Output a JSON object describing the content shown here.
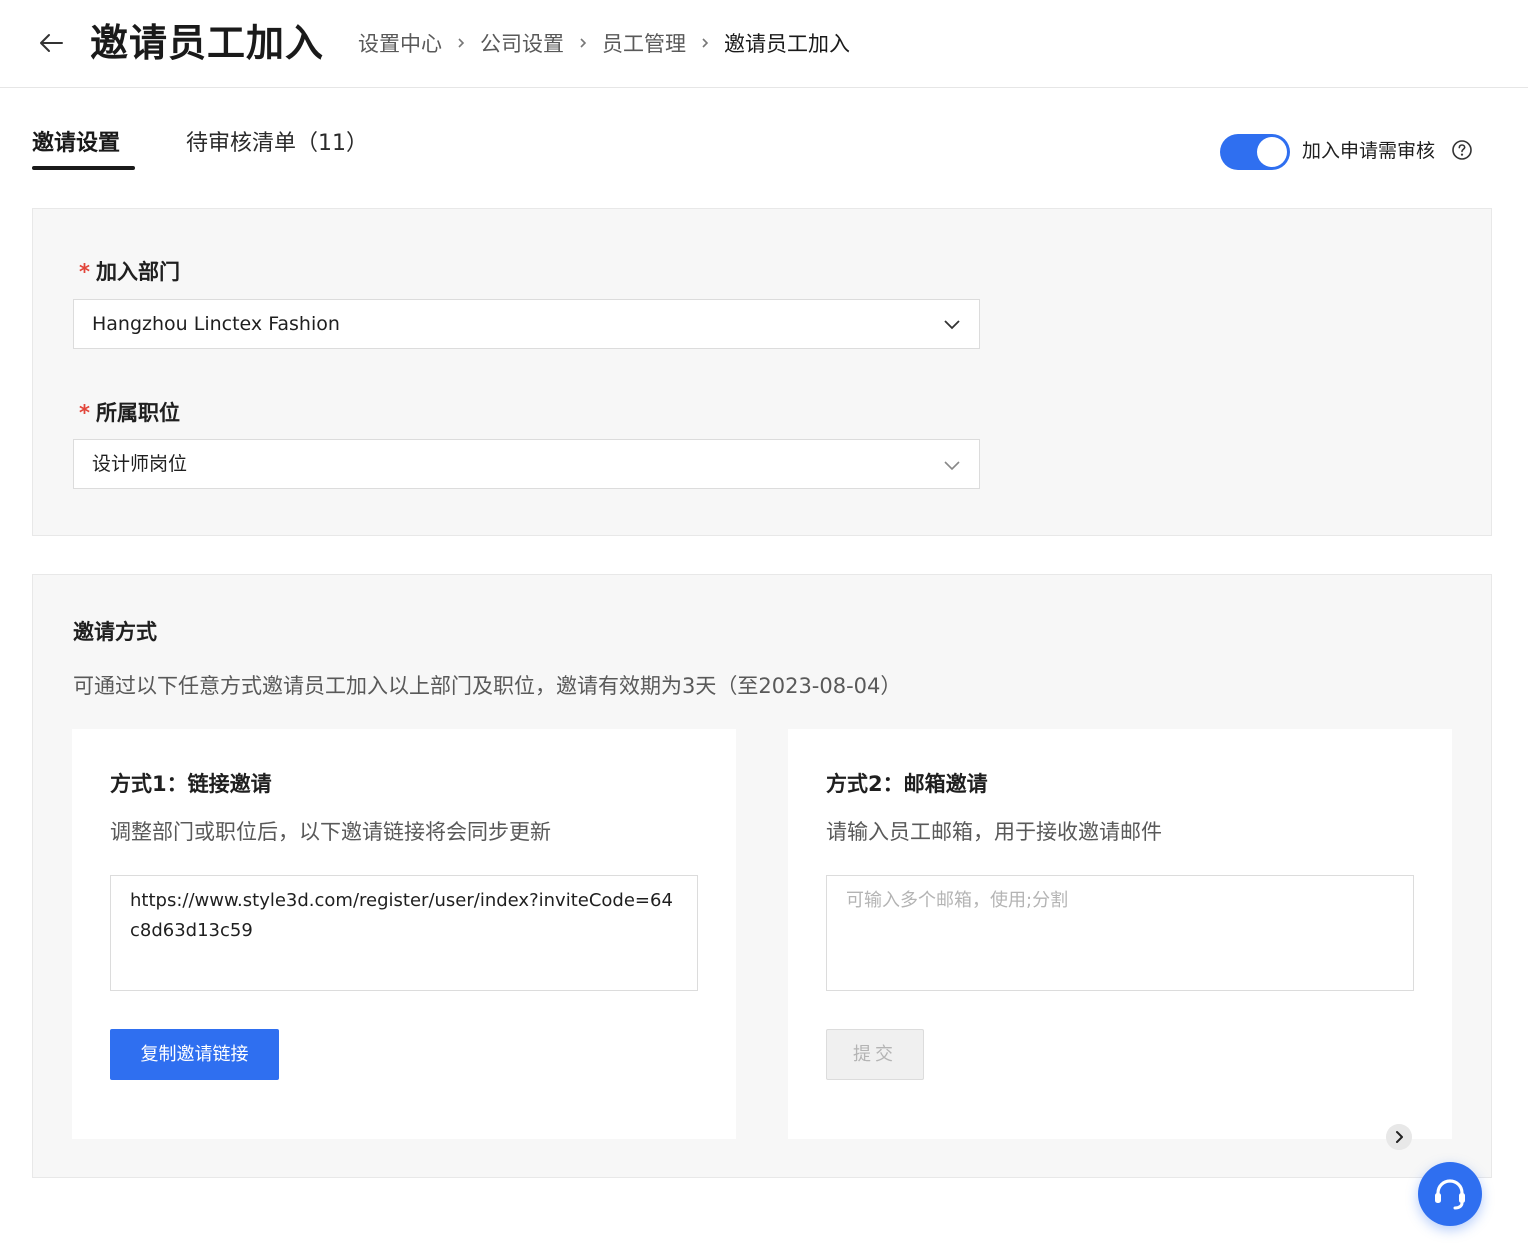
{
  "header": {
    "title": "邀请员工加入",
    "breadcrumb": [
      "设置中心",
      "公司设置",
      "员工管理",
      "邀请员工加入"
    ],
    "back_icon": "arrow-left-icon"
  },
  "tabs": [
    {
      "label": "邀请设置",
      "active": true
    },
    {
      "label": "待审核清单（11）",
      "active": false
    }
  ],
  "approval_toggle": {
    "label": "加入申请需审核",
    "on": true,
    "help_icon": "question-circle-icon"
  },
  "form": {
    "department": {
      "required_mark": "*",
      "label": "加入部门",
      "value": "Hangzhou Linctex Fashion",
      "arrow_icon": "chevron-down-icon"
    },
    "position": {
      "required_mark": "*",
      "label": "所属职位",
      "value": "设计师岗位",
      "arrow_icon": "chevron-down-icon"
    }
  },
  "invite": {
    "title": "邀请方式",
    "description": "可通过以下任意方式邀请员工加入以上部门及职位，邀请有效期为3天（至2023-08-04）",
    "link_method": {
      "title": "方式1：链接邀请",
      "description": "调整部门或职位后，以下邀请链接将会同步更新",
      "link": "https://www.style3d.com/register/user/index?inviteCode=64c8d63d13c59",
      "button": "复制邀请链接"
    },
    "email_method": {
      "title": "方式2：邮箱邀请",
      "description": "请输入员工邮箱，用于接收邀请邮件",
      "placeholder": "可输入多个邮箱，使用;分割",
      "button": "提交",
      "button_enabled": false
    }
  },
  "floating": {
    "scroll_icon": "chevron-right-icon",
    "support_icon": "headset-icon"
  },
  "colors": {
    "primary": "#2f6ff0",
    "required": "#e2453a",
    "panel_bg": "#f7f7f7"
  }
}
